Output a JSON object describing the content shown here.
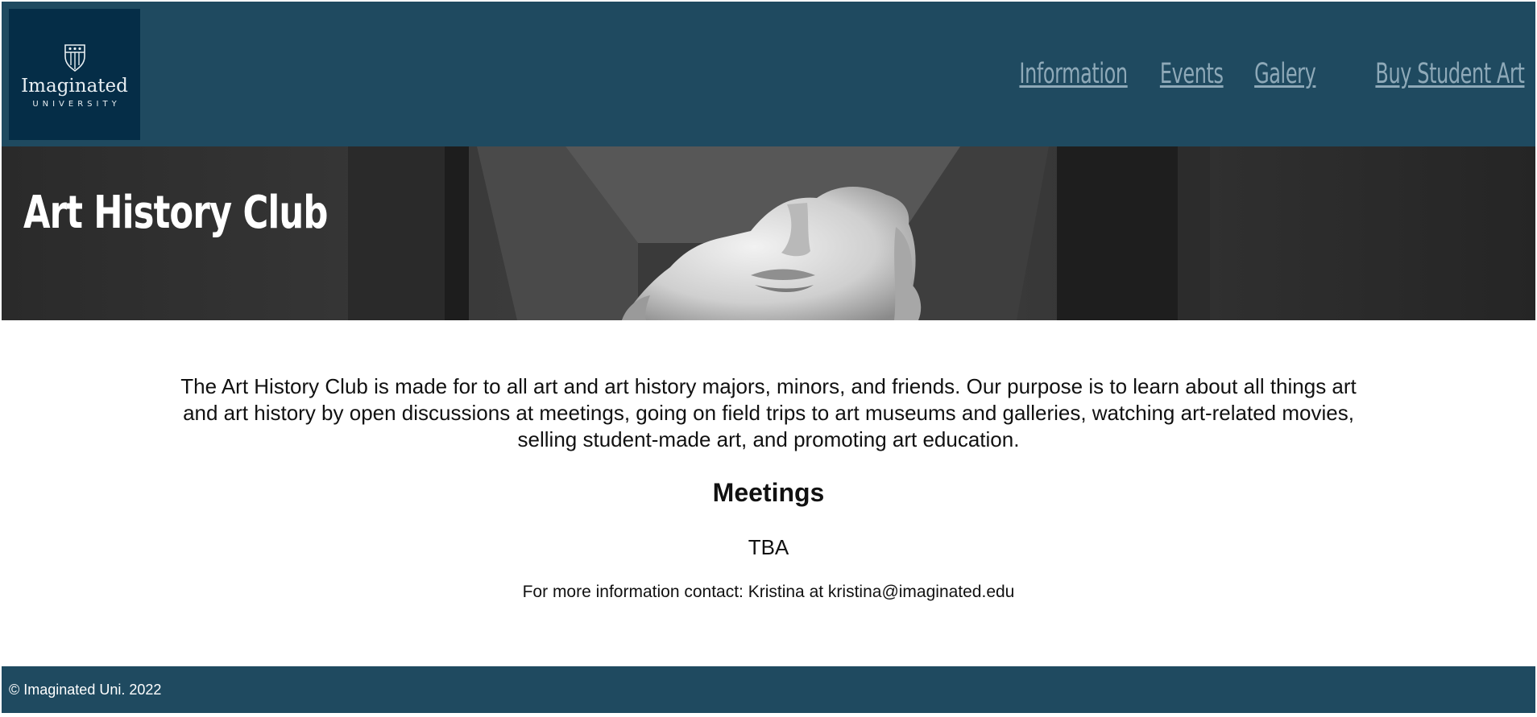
{
  "header": {
    "logo": {
      "name": "Imaginated",
      "subtitle": "UNIVERSITY",
      "icon": "shield-crest-icon"
    },
    "nav": [
      {
        "label": "Information"
      },
      {
        "label": "Events"
      },
      {
        "label": "Galery"
      },
      {
        "label": "Buy Student Art"
      }
    ]
  },
  "banner": {
    "title": "Art History Club",
    "image": "classical-statue-face-photo"
  },
  "main": {
    "intro": "The Art History Club is made for to all art and art history majors, minors, and friends. Our purpose is to learn about all things art and art history by open discussions at meetings, going on field trips to art museums and galleries, watching art-related movies, selling student-made art, and promoting art education.",
    "meetings_heading": "Meetings",
    "meetings_value": "TBA",
    "contact": "For more information contact: Kristina at kristina@imaginated.edu"
  },
  "footer": {
    "copyright": "© Imaginated Uni. 2022"
  },
  "colors": {
    "header_bg": "#1f4a60",
    "logo_bg": "#052d47",
    "nav_link": "#8ea9b8",
    "footer_bg": "#1f4a60"
  }
}
